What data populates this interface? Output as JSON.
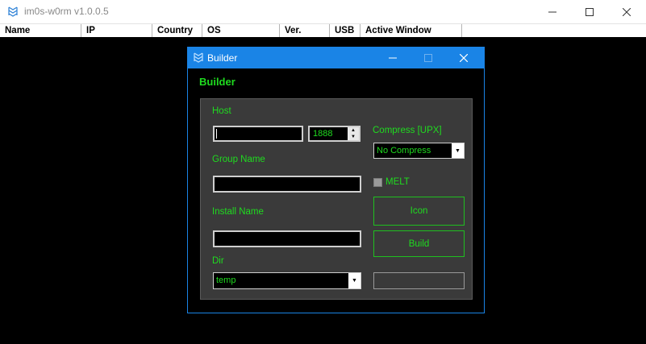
{
  "main_window": {
    "title": "im0s-w0rm v1.0.0.5",
    "columns": [
      "Name",
      "IP",
      "Country",
      "OS",
      "Ver.",
      "USB",
      "Active Window"
    ]
  },
  "builder": {
    "title": "Builder",
    "heading": "Builder",
    "host_label": "Host",
    "host_value": "",
    "port_value": "1888",
    "group_label": "Group Name",
    "group_value": "",
    "install_label": "Install Name",
    "install_value": "",
    "dir_label": "Dir",
    "dir_value": "temp",
    "compress_label": "Compress [UPX]",
    "compress_value": "No Compress",
    "melt_label": "MELT",
    "icon_button": "Icon",
    "build_button": "Build",
    "status_value": ""
  },
  "colors": {
    "accent_green": "#1fdc1f",
    "titlebar_blue": "#1a84e6",
    "panel_gray": "#3a3a3a"
  },
  "icons": [
    "app-icon",
    "minimize-icon",
    "maximize-icon",
    "close-icon",
    "chevron-down-icon",
    "spin-up-icon",
    "spin-down-icon"
  ]
}
